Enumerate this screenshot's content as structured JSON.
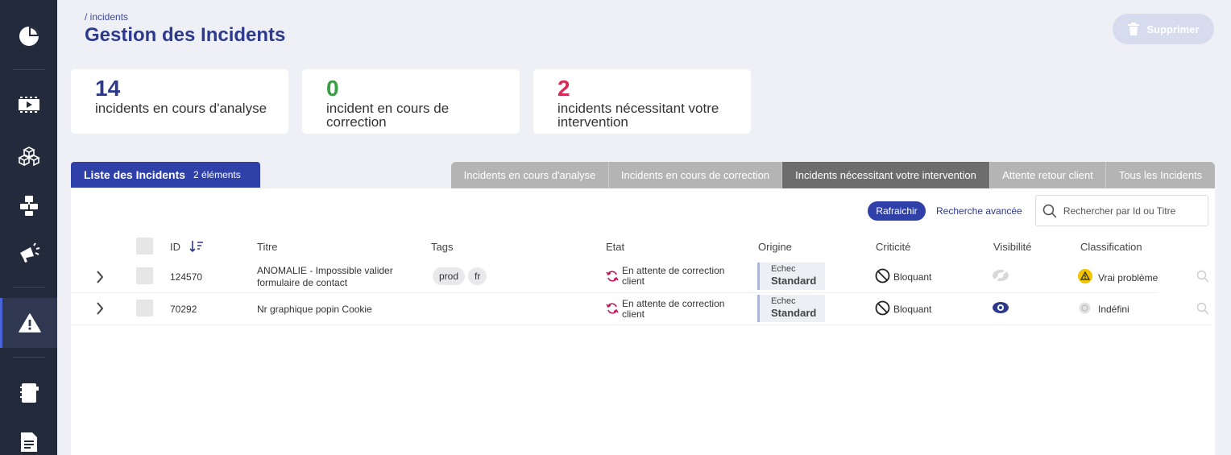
{
  "breadcrumb": "/ incidents",
  "title": "Gestion des Incidents",
  "delete_label": "Supprimer",
  "stats": [
    {
      "value": "14",
      "label": "incidents en cours d'analyse",
      "color": "#2d3a8c"
    },
    {
      "value": "0",
      "label": "incident en cours de correction",
      "color": "#3aa046"
    },
    {
      "value": "2",
      "label": "incidents nécessitant votre intervention",
      "color": "#d42b57"
    }
  ],
  "list": {
    "title": "Liste des Incidents",
    "count": "2 éléments"
  },
  "tabs": [
    {
      "label": "Incidents en cours d'analyse",
      "active": false
    },
    {
      "label": "Incidents en cours de correction",
      "active": false
    },
    {
      "label": "Incidents nécessitant votre intervention",
      "active": true
    },
    {
      "label": "Attente retour client",
      "active": false
    },
    {
      "label": "Tous les Incidents",
      "active": false
    }
  ],
  "refresh_label": "Rafraichir",
  "advanced_search_label": "Recherche avancée",
  "search_placeholder": "Rechercher par Id ou Titre",
  "columns": [
    "ID",
    "Titre",
    "Tags",
    "Etat",
    "Origine",
    "Criticité",
    "Visibilité",
    "Classification"
  ],
  "rows": [
    {
      "id": "124570",
      "title_line1": "ANOMALIE - Impossible valider",
      "title_line2": "formulaire de contact",
      "tags": [
        "prod",
        "fr"
      ],
      "etat_line1": "En attente de correction",
      "etat_line2": "client",
      "origin_line1": "Echec",
      "origin_line2": "Standard",
      "criticite": "Bloquant",
      "visibility": "hidden-eye-icon",
      "classification": "Vrai problème",
      "classification_icon": "warning-icon"
    },
    {
      "id": "70292",
      "title_line1": "Nr graphique popin Cookie",
      "title_line2": "",
      "tags": [],
      "etat_line1": "En attente de correction",
      "etat_line2": "client",
      "origin_line1": "Echec",
      "origin_line2": "Standard",
      "criticite": "Bloquant",
      "visibility": "visible-eye-icon",
      "classification": "Indéfini",
      "classification_icon": "undefined-icon"
    }
  ],
  "colors": {
    "sidebar": "#232a3b",
    "accent": "#2f41a8",
    "active_tab": "#6d6d6d",
    "tab": "#b4b4b4"
  }
}
